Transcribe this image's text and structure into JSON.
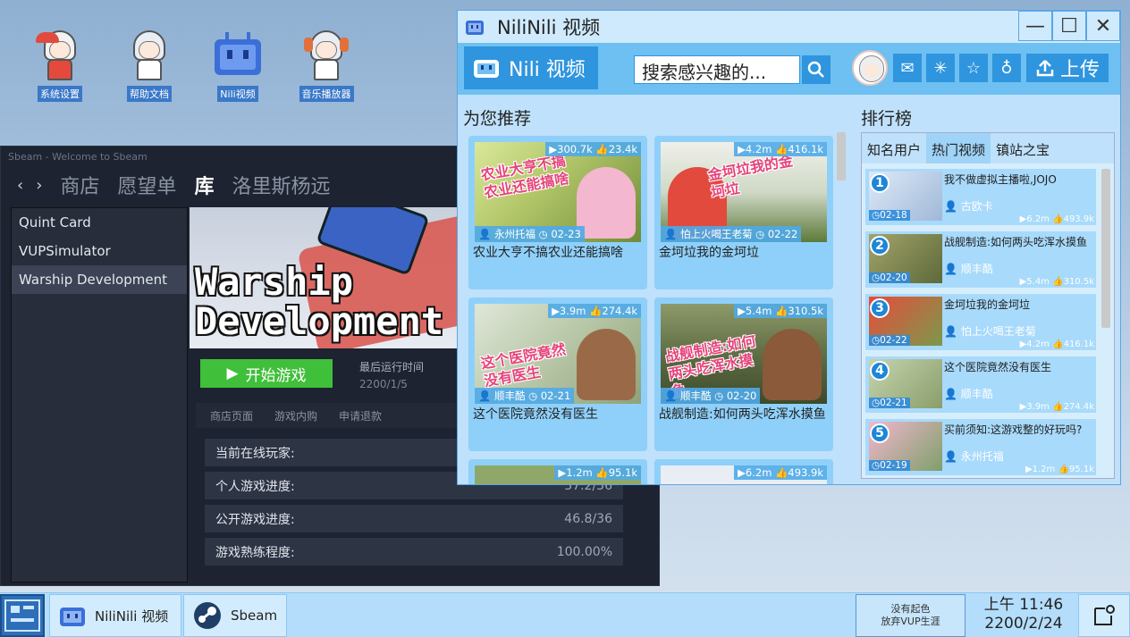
{
  "desktop": {
    "icons": [
      {
        "label": "系统设置",
        "icon": "robot-girl-wrench-icon"
      },
      {
        "label": "帮助文档",
        "icon": "girl-help-icon"
      },
      {
        "label": "Nili视频",
        "icon": "nili-tv-icon"
      },
      {
        "label": "音乐播放器",
        "icon": "girl-headphones-icon"
      }
    ]
  },
  "sbeam": {
    "title": "Sbeam - Welcome to Sbeam",
    "nav": {
      "back": "‹",
      "forward": "›",
      "items": [
        "商店",
        "愿望单",
        "库",
        "洛里斯杨远"
      ],
      "active": "库"
    },
    "library": [
      "Quint Card",
      "VUPSimulator",
      "Warship Development"
    ],
    "selected_game": "Warship Development",
    "hero_title": "Warship\nDevelopment",
    "play_label": "开始游戏",
    "last_run_label": "最后运行时间",
    "last_run_date": "2200/1/5",
    "tabs": [
      "商店页面",
      "游戏内购",
      "申请退款"
    ],
    "stats": [
      {
        "label": "当前在线玩家:",
        "value": ""
      },
      {
        "label": "个人游戏进度:",
        "value": "37.2/36"
      },
      {
        "label": "公开游戏进度:",
        "value": "46.8/36"
      },
      {
        "label": "游戏熟练程度:",
        "value": "100.00%"
      }
    ]
  },
  "nili": {
    "window_title": "NiliNili 视频",
    "brand": "Nili 视频",
    "search_text": "搜索感兴趣的...",
    "upload_label": "上传",
    "recommend_title": "为您推荐",
    "ranking_title": "排行榜",
    "videos": [
      {
        "views": "300.7k",
        "likes": "23.4k",
        "author": "永州托福",
        "date": "02-23",
        "title": "农业大亨不搞农业还能搞啥",
        "overlay": "农业大亨不搞农业还能搞啥"
      },
      {
        "views": "4.2m",
        "likes": "416.1k",
        "author": "怕上火喝王老菊",
        "date": "02-22",
        "title": "金坷垃我的金坷垃",
        "overlay": "金坷垃我的金坷垃"
      },
      {
        "views": "3.9m",
        "likes": "274.4k",
        "author": "顺丰酷",
        "date": "02-21",
        "title": "这个医院竟然没有医生",
        "overlay": "这个医院竟然没有医生"
      },
      {
        "views": "5.4m",
        "likes": "310.5k",
        "author": "顺丰酷",
        "date": "02-20",
        "title": "战舰制造:如何两头吃浑水摸鱼",
        "overlay": "战舰制造:如何两头吃浑水摸鱼"
      },
      {
        "views": "1.2m",
        "likes": "95.1k"
      },
      {
        "views": "6.2m",
        "likes": "493.9k"
      }
    ],
    "ranking_tabs": [
      "知名用户",
      "热门视频",
      "镇站之宝"
    ],
    "ranking_active": "热门视频",
    "ranking": [
      {
        "rank": "1",
        "title": "我不做虚拟主播啦,JOJO",
        "author": "古欧卡",
        "date": "02-18",
        "views": "6.2m",
        "likes": "493.9k"
      },
      {
        "rank": "2",
        "title": "战舰制造:如何两头吃浑水摸鱼",
        "author": "顺丰酷",
        "date": "02-20",
        "views": "5.4m",
        "likes": "310.5k"
      },
      {
        "rank": "3",
        "title": "金坷垃我的金坷垃",
        "author": "怕上火喝王老菊",
        "date": "02-22",
        "views": "4.2m",
        "likes": "416.1k"
      },
      {
        "rank": "4",
        "title": "这个医院竟然没有医生",
        "author": "顺丰酷",
        "date": "02-21",
        "views": "3.9m",
        "likes": "274.4k"
      },
      {
        "rank": "5",
        "title": "买前须知:这游戏整的好玩吗?",
        "author": "永州托福",
        "date": "02-19",
        "views": "1.2m",
        "likes": "95.1k"
      }
    ]
  },
  "taskbar": {
    "apps": [
      {
        "label": "NiliNili 视频",
        "icon": "nili-tv-icon"
      },
      {
        "label": "Sbeam",
        "icon": "sbeam-logo-icon"
      }
    ],
    "notice_line1": "没有起色",
    "notice_line2": "放弃VUP生涯",
    "time": "上午 11:46",
    "date": "2200/2/24"
  }
}
